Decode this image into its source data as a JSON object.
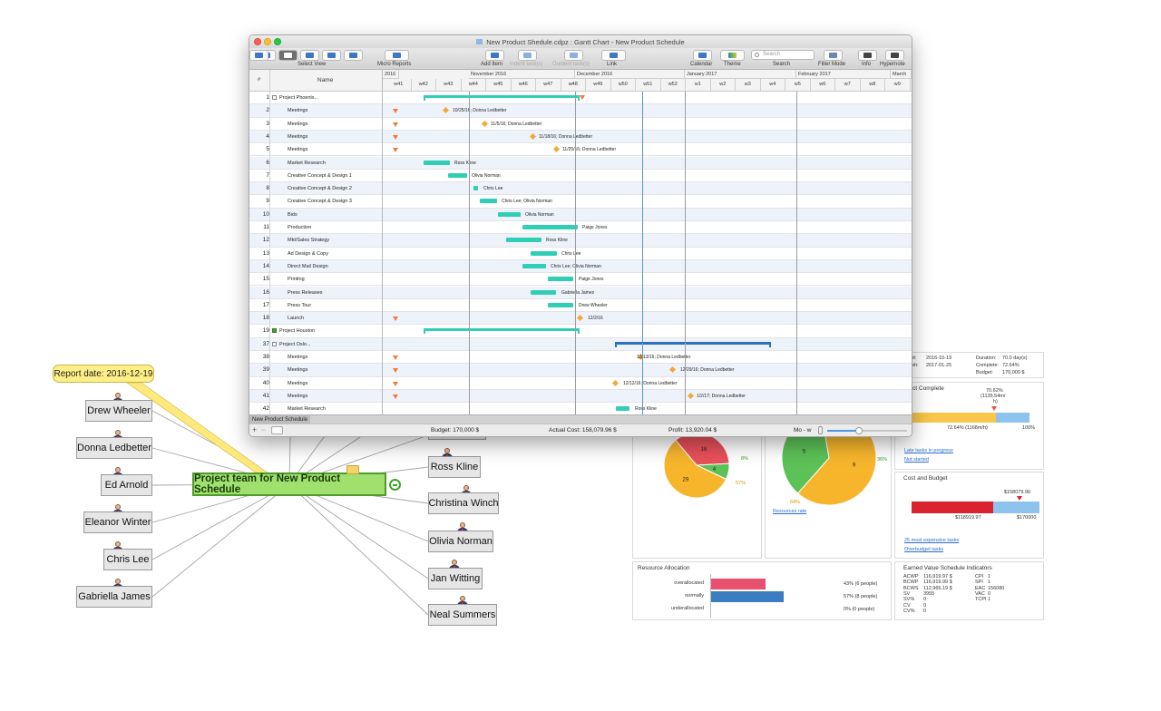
{
  "gantt": {
    "title": "New Product Shedule.cdpz : Gantt Chart - New Product Schedule",
    "toolbar": {
      "select_view": "Select View",
      "micro_reports": "Micro Reports",
      "add_item": "Add Item",
      "indent": "Indent task(s)",
      "outdent": "Outdent task(s)",
      "link": "Link",
      "calendar": "Calendar",
      "theme": "Theme",
      "search_label": "Search",
      "search_placeholder": "Search",
      "filter_mode": "Filter Mode",
      "info": "Info",
      "hypernote": "Hypernote"
    },
    "header": {
      "num": "#",
      "name": "Name"
    },
    "months": [
      "2016",
      "November 2016",
      "December 2016",
      "January 2017",
      "February 2017",
      "March"
    ],
    "weeks": [
      "w41",
      "w42",
      "w43",
      "w44",
      "w45",
      "w46",
      "w47",
      "w48",
      "w49",
      "w50",
      "w51",
      "w52",
      "w1",
      "w2",
      "w3",
      "w4",
      "w5",
      "w6",
      "w7",
      "w8",
      "w9"
    ],
    "rows": [
      {
        "num": "1",
        "name": "Project Phoenix...",
        "level": 0,
        "expand": true
      },
      {
        "num": "2",
        "name": "Meetings",
        "level": 1,
        "label": "10/25/16; Donna Ledbetter"
      },
      {
        "num": "3",
        "name": "Meetings",
        "level": 1,
        "label": "11/5/16; Donna Ledbetter"
      },
      {
        "num": "4",
        "name": "Meetings",
        "level": 1,
        "label": "11/18/16; Donna Ledbetter"
      },
      {
        "num": "5",
        "name": "Meetings",
        "level": 1,
        "label": "11/25/16; Donna Ledbetter"
      },
      {
        "num": "6",
        "name": "Market Research",
        "level": 1,
        "label": "Ross Kline"
      },
      {
        "num": "7",
        "name": "Creative Concept & Design 1",
        "level": 1,
        "label": "Olivia Norman"
      },
      {
        "num": "8",
        "name": "Creative Concept & Design 2",
        "level": 1,
        "label": "Chris Lee"
      },
      {
        "num": "9",
        "name": "Creative Concept & Design 3",
        "level": 1,
        "label": "Chris Lee; Olivia Norman"
      },
      {
        "num": "10",
        "name": "Bids",
        "level": 1,
        "label": "Olivia Norman"
      },
      {
        "num": "11",
        "name": "Production",
        "level": 1,
        "label": "Paige Jones"
      },
      {
        "num": "12",
        "name": "Mkt/Sales Strategy",
        "level": 1,
        "label": "Ross Kline"
      },
      {
        "num": "13",
        "name": "Ad Design & Copy",
        "level": 1,
        "label": "Chris Lee"
      },
      {
        "num": "14",
        "name": "Direct Mail Design",
        "level": 1,
        "label": "Chris Lee; Olivia Norman"
      },
      {
        "num": "15",
        "name": "Printing",
        "level": 1,
        "label": "Paige Jones"
      },
      {
        "num": "16",
        "name": "Press Releases",
        "level": 1,
        "label": "Gabriella  James"
      },
      {
        "num": "17",
        "name": "Press Tour",
        "level": 1,
        "label": "Drew Wheeler"
      },
      {
        "num": "18",
        "name": "Launch",
        "level": 1,
        "label": "12/2/16"
      },
      {
        "num": "19",
        "name": "Project Houston",
        "level": 0,
        "expand": true,
        "collapsed": true
      },
      {
        "num": "37",
        "name": "Project Oslo...",
        "level": 0,
        "expand": true
      },
      {
        "num": "38",
        "name": "Meetings",
        "level": 1,
        "label": "12/13/16; Donna Ledbetter"
      },
      {
        "num": "39",
        "name": "Meetings",
        "level": 1,
        "label": "12/29/16; Donna Ledbetter"
      },
      {
        "num": "40",
        "name": "Meetings",
        "level": 1,
        "label": "12/12/16; Donna Ledbetter"
      },
      {
        "num": "41",
        "name": "Meetings",
        "level": 1,
        "label": "1/2/17; Donna Ledbetter"
      },
      {
        "num": "42",
        "name": "Market Research",
        "level": 1,
        "label": "Ross Kline"
      }
    ],
    "tab": "New Product Schedule",
    "status": {
      "budget": "Budget: 170,000 $",
      "actual": "Actual Cost: 158,079.96 $",
      "profit": "Profit: 13,920.04 $",
      "zoom": "Mo - w"
    }
  },
  "dashboard": {
    "summary": {
      "start_label": "tart:",
      "start_value": "2016-10-19",
      "finish_label": "nish:",
      "finish_value": "2017-01-25",
      "duration_label": "Duration:",
      "duration_value": "70.0 day(s)",
      "complete_label": "Complete:",
      "complete_value": "72.64%",
      "budget_label": "Budget:",
      "budget_value": "170,000 $"
    },
    "project_complete": {
      "title": "ject Complete",
      "marker_label": "70.62%",
      "marker_sub": "(1135.54m/",
      "marker_sub2": "h)",
      "left_label": "72.64% (1168m/h)",
      "right_label": "100%",
      "progress_percent": 72.64,
      "link1": "Late tasks in progress",
      "link2": "Not started"
    },
    "pie1": {
      "slices": [
        {
          "label": "18",
          "value": 18,
          "color": "#e8505a"
        },
        {
          "label": "4",
          "value": 4,
          "color": "#5cc157"
        },
        {
          "label": "29",
          "value": 29,
          "color": "#f7b52c"
        }
      ],
      "pct_green": "8%",
      "pct_orange": "57%"
    },
    "pie2": {
      "slices": [
        {
          "label": "9",
          "value": 9,
          "color": "#f7b52c"
        },
        {
          "label": "5",
          "value": 5,
          "color": "#5cc157"
        }
      ],
      "pct_green": "36%",
      "pct_orange": "64%",
      "link": "Resources rate"
    },
    "cost_budget": {
      "title": "Cost and Budget",
      "marker_value": "$158079.96",
      "left_value": "$118919.97",
      "right_value": "$170000",
      "link1": "25 most expensive tasks",
      "link2": "Overbudget tasks"
    },
    "resource_allocation": {
      "title": "Resource Allocation",
      "rows": [
        {
          "label": "overallocated",
          "pct": "43% (6 people)",
          "share": 43,
          "color": "#e8506e"
        },
        {
          "label": "normally",
          "pct": "57% (8 people)",
          "share": 57,
          "color": "#3a7dc0"
        },
        {
          "label": "underallocated",
          "pct": "0% (0 people)",
          "share": 0,
          "color": "#3a7dc0"
        }
      ]
    },
    "earned_value": {
      "title": "Earned Value Schedule Indicators",
      "left": [
        {
          "k": "ACWP",
          "v": "116,919.97 $"
        },
        {
          "k": "BCWP",
          "v": "116,919.99 $"
        },
        {
          "k": "BCWS",
          "v": "112,965.19 $"
        },
        {
          "k": "SV",
          "v": "3955"
        },
        {
          "k": "SV%",
          "v": "0"
        },
        {
          "k": "CV",
          "v": "0"
        },
        {
          "k": "CV%",
          "v": "0"
        }
      ],
      "right": [
        {
          "k": "CPI",
          "v": "1"
        },
        {
          "k": "SPI",
          "v": "1"
        },
        {
          "k": "EAC",
          "v": "156080"
        },
        {
          "k": "VAC",
          "v": "0"
        },
        {
          "k": "TCPI",
          "v": "1"
        }
      ]
    }
  },
  "mindmap": {
    "central": "Project team for New Product Schedule",
    "callout": "Report date: 2016-12-19",
    "left_nodes": [
      "Drew Wheeler",
      "Donna Ledbetter",
      "Ed Arnold",
      "Eleanor Winter",
      "Chris Lee",
      "Gabriella  James"
    ],
    "right_nodes": [
      "Ross Kline",
      "Christina Winch",
      "Olivia Norman",
      "Jan Witting",
      "Neal Summers"
    ]
  }
}
